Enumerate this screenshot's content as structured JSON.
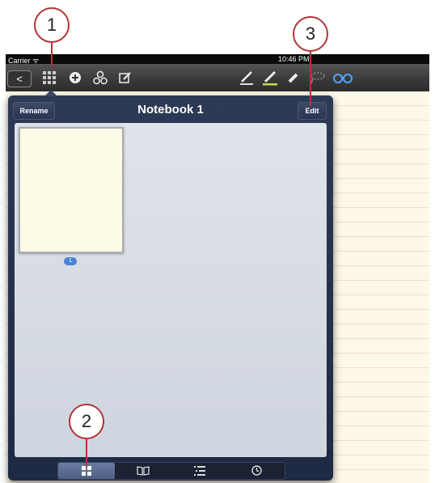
{
  "callouts": [
    {
      "label": "1"
    },
    {
      "label": "2"
    },
    {
      "label": "3"
    }
  ],
  "status_bar": {
    "carrier": "Carrier",
    "time": "10:46 PM"
  },
  "toolbar": {
    "back_glyph": "<"
  },
  "popover": {
    "title": "Notebook 1",
    "rename_label": "Rename",
    "edit_label": "Edit",
    "page_badge": "1"
  },
  "tabs": [
    {
      "icon": "grid-icon",
      "active": true
    },
    {
      "icon": "book-icon",
      "active": false
    },
    {
      "icon": "list-icon",
      "active": false
    },
    {
      "icon": "clock-icon",
      "active": false
    }
  ],
  "colors": {
    "callout": "#b3343a",
    "popover": "#25304a",
    "paper": "#fdf8e7",
    "badge": "#4a82d6",
    "highlighter": "#c9d85a",
    "glasses": "#4da6ff"
  }
}
